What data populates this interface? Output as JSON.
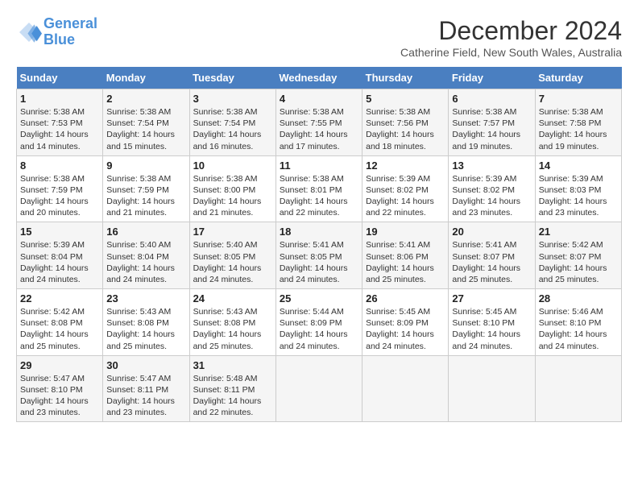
{
  "logo": {
    "line1": "General",
    "line2": "Blue"
  },
  "title": "December 2024",
  "location": "Catherine Field, New South Wales, Australia",
  "days_of_week": [
    "Sunday",
    "Monday",
    "Tuesday",
    "Wednesday",
    "Thursday",
    "Friday",
    "Saturday"
  ],
  "weeks": [
    [
      {
        "day": "1",
        "sunrise": "Sunrise: 5:38 AM",
        "sunset": "Sunset: 7:53 PM",
        "daylight": "Daylight: 14 hours and 14 minutes."
      },
      {
        "day": "2",
        "sunrise": "Sunrise: 5:38 AM",
        "sunset": "Sunset: 7:54 PM",
        "daylight": "Daylight: 14 hours and 15 minutes."
      },
      {
        "day": "3",
        "sunrise": "Sunrise: 5:38 AM",
        "sunset": "Sunset: 7:54 PM",
        "daylight": "Daylight: 14 hours and 16 minutes."
      },
      {
        "day": "4",
        "sunrise": "Sunrise: 5:38 AM",
        "sunset": "Sunset: 7:55 PM",
        "daylight": "Daylight: 14 hours and 17 minutes."
      },
      {
        "day": "5",
        "sunrise": "Sunrise: 5:38 AM",
        "sunset": "Sunset: 7:56 PM",
        "daylight": "Daylight: 14 hours and 18 minutes."
      },
      {
        "day": "6",
        "sunrise": "Sunrise: 5:38 AM",
        "sunset": "Sunset: 7:57 PM",
        "daylight": "Daylight: 14 hours and 19 minutes."
      },
      {
        "day": "7",
        "sunrise": "Sunrise: 5:38 AM",
        "sunset": "Sunset: 7:58 PM",
        "daylight": "Daylight: 14 hours and 19 minutes."
      }
    ],
    [
      {
        "day": "8",
        "sunrise": "Sunrise: 5:38 AM",
        "sunset": "Sunset: 7:59 PM",
        "daylight": "Daylight: 14 hours and 20 minutes."
      },
      {
        "day": "9",
        "sunrise": "Sunrise: 5:38 AM",
        "sunset": "Sunset: 7:59 PM",
        "daylight": "Daylight: 14 hours and 21 minutes."
      },
      {
        "day": "10",
        "sunrise": "Sunrise: 5:38 AM",
        "sunset": "Sunset: 8:00 PM",
        "daylight": "Daylight: 14 hours and 21 minutes."
      },
      {
        "day": "11",
        "sunrise": "Sunrise: 5:38 AM",
        "sunset": "Sunset: 8:01 PM",
        "daylight": "Daylight: 14 hours and 22 minutes."
      },
      {
        "day": "12",
        "sunrise": "Sunrise: 5:39 AM",
        "sunset": "Sunset: 8:02 PM",
        "daylight": "Daylight: 14 hours and 22 minutes."
      },
      {
        "day": "13",
        "sunrise": "Sunrise: 5:39 AM",
        "sunset": "Sunset: 8:02 PM",
        "daylight": "Daylight: 14 hours and 23 minutes."
      },
      {
        "day": "14",
        "sunrise": "Sunrise: 5:39 AM",
        "sunset": "Sunset: 8:03 PM",
        "daylight": "Daylight: 14 hours and 23 minutes."
      }
    ],
    [
      {
        "day": "15",
        "sunrise": "Sunrise: 5:39 AM",
        "sunset": "Sunset: 8:04 PM",
        "daylight": "Daylight: 14 hours and 24 minutes."
      },
      {
        "day": "16",
        "sunrise": "Sunrise: 5:40 AM",
        "sunset": "Sunset: 8:04 PM",
        "daylight": "Daylight: 14 hours and 24 minutes."
      },
      {
        "day": "17",
        "sunrise": "Sunrise: 5:40 AM",
        "sunset": "Sunset: 8:05 PM",
        "daylight": "Daylight: 14 hours and 24 minutes."
      },
      {
        "day": "18",
        "sunrise": "Sunrise: 5:41 AM",
        "sunset": "Sunset: 8:05 PM",
        "daylight": "Daylight: 14 hours and 24 minutes."
      },
      {
        "day": "19",
        "sunrise": "Sunrise: 5:41 AM",
        "sunset": "Sunset: 8:06 PM",
        "daylight": "Daylight: 14 hours and 25 minutes."
      },
      {
        "day": "20",
        "sunrise": "Sunrise: 5:41 AM",
        "sunset": "Sunset: 8:07 PM",
        "daylight": "Daylight: 14 hours and 25 minutes."
      },
      {
        "day": "21",
        "sunrise": "Sunrise: 5:42 AM",
        "sunset": "Sunset: 8:07 PM",
        "daylight": "Daylight: 14 hours and 25 minutes."
      }
    ],
    [
      {
        "day": "22",
        "sunrise": "Sunrise: 5:42 AM",
        "sunset": "Sunset: 8:08 PM",
        "daylight": "Daylight: 14 hours and 25 minutes."
      },
      {
        "day": "23",
        "sunrise": "Sunrise: 5:43 AM",
        "sunset": "Sunset: 8:08 PM",
        "daylight": "Daylight: 14 hours and 25 minutes."
      },
      {
        "day": "24",
        "sunrise": "Sunrise: 5:43 AM",
        "sunset": "Sunset: 8:08 PM",
        "daylight": "Daylight: 14 hours and 25 minutes."
      },
      {
        "day": "25",
        "sunrise": "Sunrise: 5:44 AM",
        "sunset": "Sunset: 8:09 PM",
        "daylight": "Daylight: 14 hours and 24 minutes."
      },
      {
        "day": "26",
        "sunrise": "Sunrise: 5:45 AM",
        "sunset": "Sunset: 8:09 PM",
        "daylight": "Daylight: 14 hours and 24 minutes."
      },
      {
        "day": "27",
        "sunrise": "Sunrise: 5:45 AM",
        "sunset": "Sunset: 8:10 PM",
        "daylight": "Daylight: 14 hours and 24 minutes."
      },
      {
        "day": "28",
        "sunrise": "Sunrise: 5:46 AM",
        "sunset": "Sunset: 8:10 PM",
        "daylight": "Daylight: 14 hours and 24 minutes."
      }
    ],
    [
      {
        "day": "29",
        "sunrise": "Sunrise: 5:47 AM",
        "sunset": "Sunset: 8:10 PM",
        "daylight": "Daylight: 14 hours and 23 minutes."
      },
      {
        "day": "30",
        "sunrise": "Sunrise: 5:47 AM",
        "sunset": "Sunset: 8:11 PM",
        "daylight": "Daylight: 14 hours and 23 minutes."
      },
      {
        "day": "31",
        "sunrise": "Sunrise: 5:48 AM",
        "sunset": "Sunset: 8:11 PM",
        "daylight": "Daylight: 14 hours and 22 minutes."
      },
      null,
      null,
      null,
      null
    ]
  ]
}
